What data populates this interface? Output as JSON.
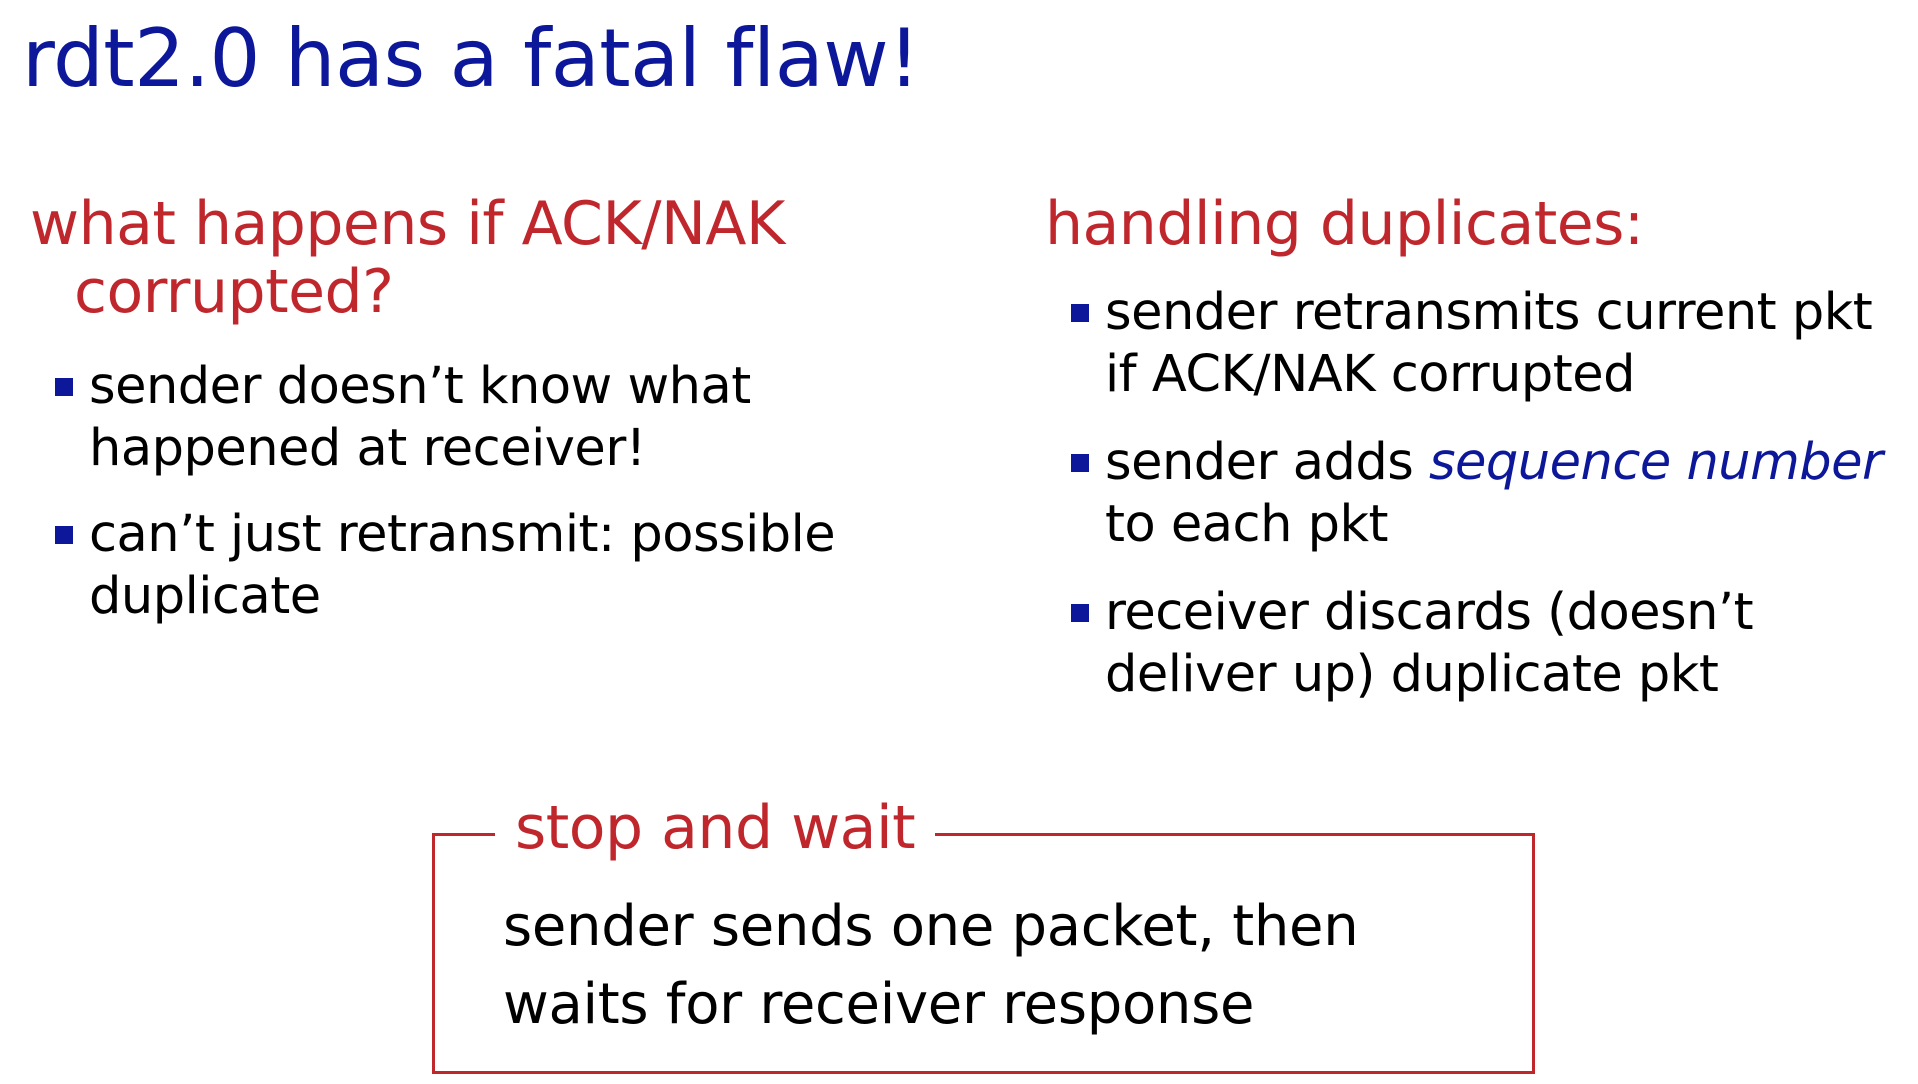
{
  "slide": {
    "title": "rdt2.0 has a fatal flaw!"
  },
  "left": {
    "heading": "what happens if ACK/NAK corrupted?",
    "bullets": [
      "sender doesn’t know what happened at receiver!",
      "can’t just retransmit: possible duplicate"
    ]
  },
  "right": {
    "heading": "handling duplicates:",
    "bullets": [
      {
        "text": "sender retransmits current pkt if ACK/NAK corrupted"
      },
      {
        "before": "sender adds ",
        "emphasis": "sequence number",
        "after": " to each pkt"
      },
      {
        "text": "receiver discards (doesn’t deliver up) duplicate pkt"
      }
    ]
  },
  "box": {
    "legend": "stop and wait",
    "line1": "sender sends one packet,  then",
    "line2": "waits for receiver  response"
  },
  "colors": {
    "title": "#0c1899",
    "heading": "#c0272d",
    "bullet": "#0c1899",
    "emphasis": "#0c1899",
    "box_border": "#c0272d"
  }
}
